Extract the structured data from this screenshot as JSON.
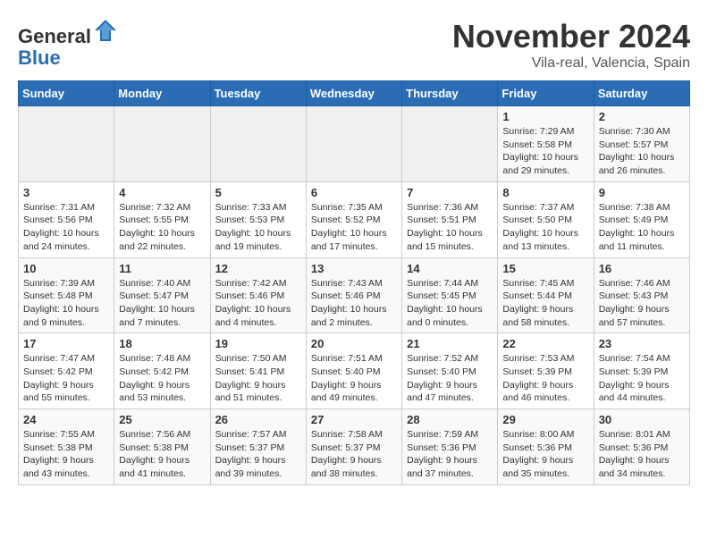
{
  "header": {
    "logo_general": "General",
    "logo_blue": "Blue",
    "month": "November 2024",
    "location": "Vila-real, Valencia, Spain"
  },
  "weekdays": [
    "Sunday",
    "Monday",
    "Tuesday",
    "Wednesday",
    "Thursday",
    "Friday",
    "Saturday"
  ],
  "weeks": [
    [
      {
        "day": "",
        "info": ""
      },
      {
        "day": "",
        "info": ""
      },
      {
        "day": "",
        "info": ""
      },
      {
        "day": "",
        "info": ""
      },
      {
        "day": "",
        "info": ""
      },
      {
        "day": "1",
        "info": "Sunrise: 7:29 AM\nSunset: 5:58 PM\nDaylight: 10 hours and 29 minutes."
      },
      {
        "day": "2",
        "info": "Sunrise: 7:30 AM\nSunset: 5:57 PM\nDaylight: 10 hours and 26 minutes."
      }
    ],
    [
      {
        "day": "3",
        "info": "Sunrise: 7:31 AM\nSunset: 5:56 PM\nDaylight: 10 hours and 24 minutes."
      },
      {
        "day": "4",
        "info": "Sunrise: 7:32 AM\nSunset: 5:55 PM\nDaylight: 10 hours and 22 minutes."
      },
      {
        "day": "5",
        "info": "Sunrise: 7:33 AM\nSunset: 5:53 PM\nDaylight: 10 hours and 19 minutes."
      },
      {
        "day": "6",
        "info": "Sunrise: 7:35 AM\nSunset: 5:52 PM\nDaylight: 10 hours and 17 minutes."
      },
      {
        "day": "7",
        "info": "Sunrise: 7:36 AM\nSunset: 5:51 PM\nDaylight: 10 hours and 15 minutes."
      },
      {
        "day": "8",
        "info": "Sunrise: 7:37 AM\nSunset: 5:50 PM\nDaylight: 10 hours and 13 minutes."
      },
      {
        "day": "9",
        "info": "Sunrise: 7:38 AM\nSunset: 5:49 PM\nDaylight: 10 hours and 11 minutes."
      }
    ],
    [
      {
        "day": "10",
        "info": "Sunrise: 7:39 AM\nSunset: 5:48 PM\nDaylight: 10 hours and 9 minutes."
      },
      {
        "day": "11",
        "info": "Sunrise: 7:40 AM\nSunset: 5:47 PM\nDaylight: 10 hours and 7 minutes."
      },
      {
        "day": "12",
        "info": "Sunrise: 7:42 AM\nSunset: 5:46 PM\nDaylight: 10 hours and 4 minutes."
      },
      {
        "day": "13",
        "info": "Sunrise: 7:43 AM\nSunset: 5:46 PM\nDaylight: 10 hours and 2 minutes."
      },
      {
        "day": "14",
        "info": "Sunrise: 7:44 AM\nSunset: 5:45 PM\nDaylight: 10 hours and 0 minutes."
      },
      {
        "day": "15",
        "info": "Sunrise: 7:45 AM\nSunset: 5:44 PM\nDaylight: 9 hours and 58 minutes."
      },
      {
        "day": "16",
        "info": "Sunrise: 7:46 AM\nSunset: 5:43 PM\nDaylight: 9 hours and 57 minutes."
      }
    ],
    [
      {
        "day": "17",
        "info": "Sunrise: 7:47 AM\nSunset: 5:42 PM\nDaylight: 9 hours and 55 minutes."
      },
      {
        "day": "18",
        "info": "Sunrise: 7:48 AM\nSunset: 5:42 PM\nDaylight: 9 hours and 53 minutes."
      },
      {
        "day": "19",
        "info": "Sunrise: 7:50 AM\nSunset: 5:41 PM\nDaylight: 9 hours and 51 minutes."
      },
      {
        "day": "20",
        "info": "Sunrise: 7:51 AM\nSunset: 5:40 PM\nDaylight: 9 hours and 49 minutes."
      },
      {
        "day": "21",
        "info": "Sunrise: 7:52 AM\nSunset: 5:40 PM\nDaylight: 9 hours and 47 minutes."
      },
      {
        "day": "22",
        "info": "Sunrise: 7:53 AM\nSunset: 5:39 PM\nDaylight: 9 hours and 46 minutes."
      },
      {
        "day": "23",
        "info": "Sunrise: 7:54 AM\nSunset: 5:39 PM\nDaylight: 9 hours and 44 minutes."
      }
    ],
    [
      {
        "day": "24",
        "info": "Sunrise: 7:55 AM\nSunset: 5:38 PM\nDaylight: 9 hours and 43 minutes."
      },
      {
        "day": "25",
        "info": "Sunrise: 7:56 AM\nSunset: 5:38 PM\nDaylight: 9 hours and 41 minutes."
      },
      {
        "day": "26",
        "info": "Sunrise: 7:57 AM\nSunset: 5:37 PM\nDaylight: 9 hours and 39 minutes."
      },
      {
        "day": "27",
        "info": "Sunrise: 7:58 AM\nSunset: 5:37 PM\nDaylight: 9 hours and 38 minutes."
      },
      {
        "day": "28",
        "info": "Sunrise: 7:59 AM\nSunset: 5:36 PM\nDaylight: 9 hours and 37 minutes."
      },
      {
        "day": "29",
        "info": "Sunrise: 8:00 AM\nSunset: 5:36 PM\nDaylight: 9 hours and 35 minutes."
      },
      {
        "day": "30",
        "info": "Sunrise: 8:01 AM\nSunset: 5:36 PM\nDaylight: 9 hours and 34 minutes."
      }
    ]
  ]
}
